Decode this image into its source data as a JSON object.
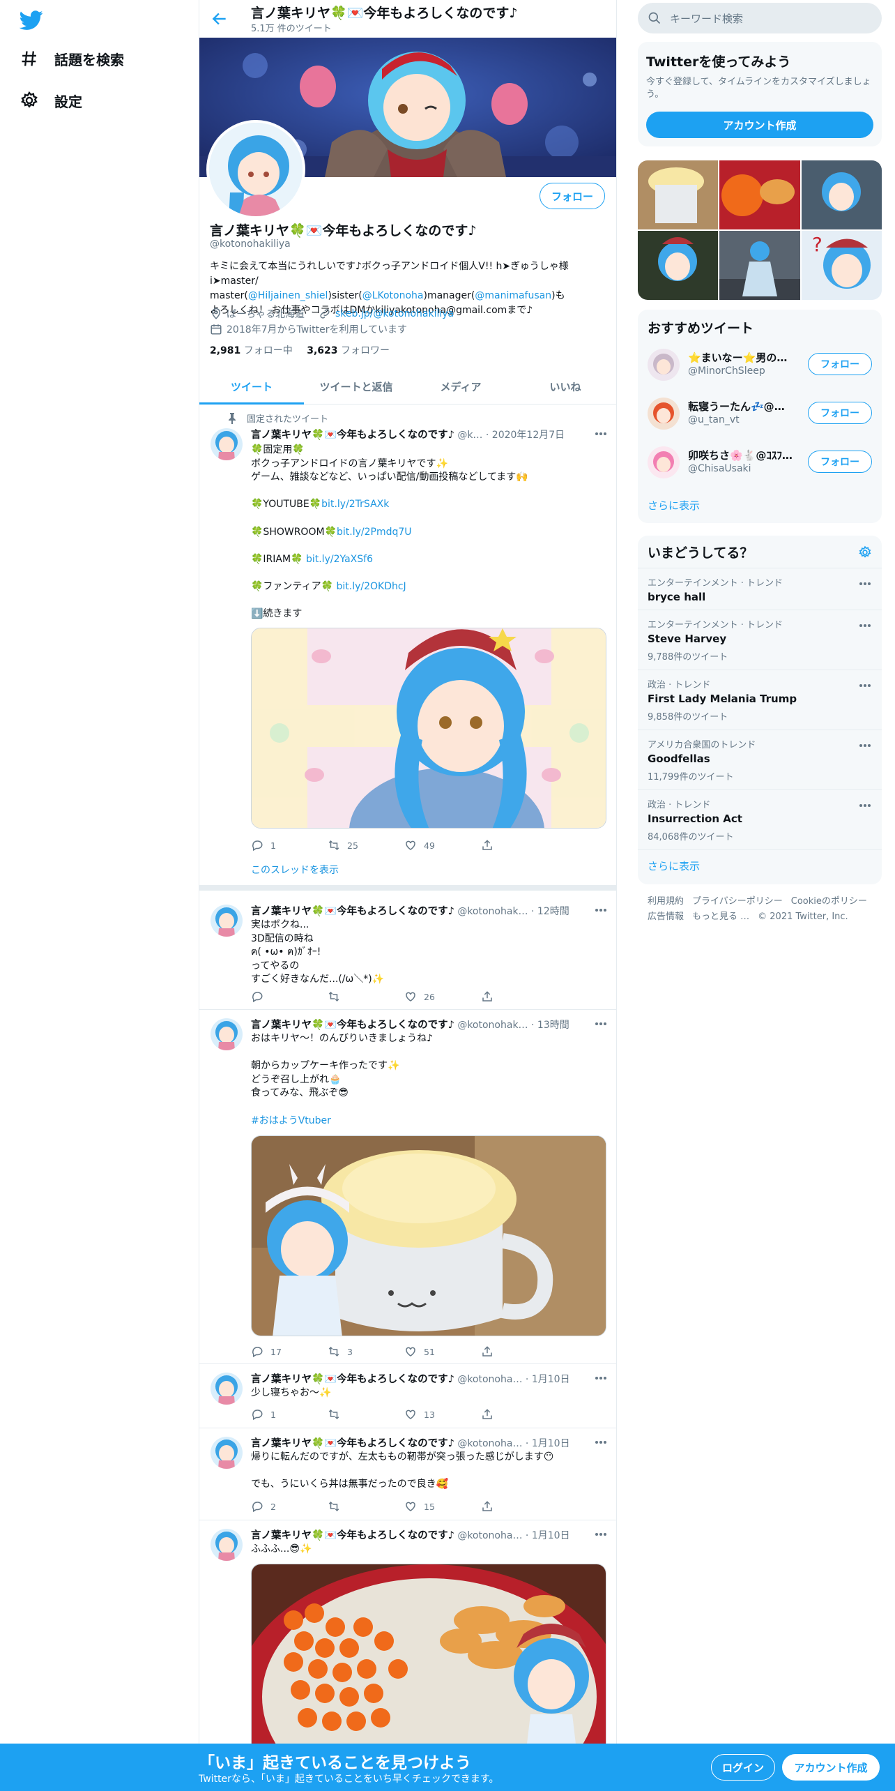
{
  "nav": {
    "explore": "話題を検索",
    "settings": "設定"
  },
  "header": {
    "title": "言ノ葉キリヤ🍀💌今年もよろしくなのです♪",
    "tweet_count": "5.1万 件のツイート"
  },
  "profile": {
    "name": "言ノ葉キリヤ🍀💌今年もよろしくなのです♪",
    "handle": "@kotonohakiliya",
    "follow_label": "フォロー",
    "bio_1": "キミに会えて本当にうれしいです♪ボクっ子アンドロイド個人V!! h➤ぎゅうしゃ様",
    "bio_2a": "i➤master/ master(",
    "bio_m1": "@Hiljainen_shiel",
    "bio_2b": ")sister(",
    "bio_m2": "@LKotonoha",
    "bio_2c": ")manager(",
    "bio_m3": "@manimafusan",
    "bio_2d": ")も",
    "bio_3": "よろしくね！ お仕事やコラボはDMかkiliyakotonoha@gmail.comまで♪",
    "location": "ぱーちゃる北海道",
    "url": "skeb.jp/@kotonohakiliya",
    "joined": "2018年7月からTwitterを利用しています",
    "following_count": "2,981",
    "following_label": "フォロー中",
    "followers_count": "3,623",
    "followers_label": "フォロワー"
  },
  "tabs": [
    "ツイート",
    "ツイートと返信",
    "メディア",
    "いいね"
  ],
  "tweets": [
    {
      "pinned_label": "固定されたツイート",
      "name": "言ノ葉キリヤ🍀💌今年もよろしくなのです♪",
      "handle": "@k…",
      "time": "2020年12月7日",
      "lines": [
        "🍀固定用🍀",
        "ボクっ子アンドロイドの言ノ葉キリヤです✨",
        "ゲーム、雑談などなど、いっぱい配信/動画投稿などしてます🙌"
      ],
      "link1_pre": "🍀YOUTUBE🍀",
      "link1": "bit.ly/2TrSAXk",
      "link2_pre": "🍀SHOWROOM🍀",
      "link2": "bit.ly/2Pmdq7U",
      "link3_pre": "🍀IRIAM🍀 ",
      "link3": "bit.ly/2YaXSf6",
      "link4_pre": "🍀ファンティア🍀 ",
      "link4": "bit.ly/2OKDhcJ",
      "cont": "⬇️続きます",
      "reply": "1",
      "retweet": "25",
      "like": "49",
      "thread_label": "このスレッドを表示"
    },
    {
      "name": "言ノ葉キリヤ🍀💌今年もよろしくなのです♪",
      "handle": "@kotonohak…",
      "time": "12時間",
      "text": "実はボクね...\n3D配信の時ね\nฅ( •ω• ฅ)ｶﾞｵｰ!\nってやるの\nすごく好きなんだ...(/ω＼*)✨",
      "reply": "",
      "retweet": "",
      "like": "26"
    },
    {
      "name": "言ノ葉キリヤ🍀💌今年もよろしくなのです♪",
      "handle": "@kotonohak…",
      "time": "13時間",
      "text": "おはキリヤ～！のんびりいきましょうね♪\n\n朝からカップケーキ作ったです✨\nどうぞ召し上がれ🧁\n食ってみな、飛ぶぞ😎",
      "hashtag": "#おはようVtuber",
      "reply": "17",
      "retweet": "3",
      "like": "51"
    },
    {
      "name": "言ノ葉キリヤ🍀💌今年もよろしくなのです♪",
      "handle": "@kotonoha…",
      "time": "1月10日",
      "text": "少し寝ちゃお～✨",
      "reply": "1",
      "retweet": "",
      "like": "13"
    },
    {
      "name": "言ノ葉キリヤ🍀💌今年もよろしくなのです♪",
      "handle": "@kotonoha…",
      "time": "1月10日",
      "text": "帰りに転んだのですが、左太ももの靭帯が突っ張った感じがします😶\n\nでも、うにいくら丼は無事だったので良き🥰",
      "reply": "2",
      "retweet": "",
      "like": "15"
    },
    {
      "name": "言ノ葉キリヤ🍀💌今年もよろしくなのです♪",
      "handle": "@kotonoha…",
      "time": "1月10日",
      "text": "ふふふ...😎✨"
    }
  ],
  "search": {
    "placeholder": "キーワード検索"
  },
  "signup": {
    "title": "Twitterを使ってみよう",
    "desc": "今すぐ登録して、タイムラインをカスタマイズしましょう。",
    "button": "アカウント作成"
  },
  "recommended": {
    "title": "おすすめツイート",
    "users": [
      {
        "name": "⭐まいなー⭐男の…",
        "handle": "@MinorChSleep",
        "button": "フォロー"
      },
      {
        "name": "転寝うーたん💤@眠…",
        "handle": "@u_tan_vt",
        "button": "フォロー"
      },
      {
        "name": "卯咲ちさ🌸🐇@ｺｽﾌ…",
        "handle": "@ChisaUsaki",
        "button": "フォロー"
      }
    ],
    "more": "さらに表示"
  },
  "trends": {
    "title": "いまどうしてる？",
    "items": [
      {
        "context": "エンターテインメント · トレンド",
        "name": "bryce hall",
        "count": ""
      },
      {
        "context": "エンターテインメント · トレンド",
        "name": "Steve Harvey",
        "count": "9,788件のツイート"
      },
      {
        "context": "政治 · トレンド",
        "name": "First Lady Melania Trump",
        "count": "9,858件のツイート"
      },
      {
        "context": "アメリカ合衆国のトレンド",
        "name": "Goodfellas",
        "count": "11,799件のツイート"
      },
      {
        "context": "政治 · トレンド",
        "name": "Insurrection Act",
        "count": "84,068件のツイート"
      }
    ],
    "more": "さらに表示"
  },
  "footer": {
    "terms": "利用規約",
    "privacy": "プライバシーポリシー",
    "cookie": "Cookieのポリシー",
    "ads": "広告情報",
    "more": "もっと見る …",
    "copyright": "© 2021 Twitter, Inc."
  },
  "bottombar": {
    "headline": "「いま」起きていることを見つけよう",
    "sub": "Twitterなら、「いま」起きていることをいち早くチェックできます。",
    "login": "ログイン",
    "signup": "アカウント作成"
  },
  "colors": {
    "accent": "#1da1f2",
    "link": "#1b95e0",
    "muted": "#657786",
    "card_bg": "#f5f8fa"
  }
}
